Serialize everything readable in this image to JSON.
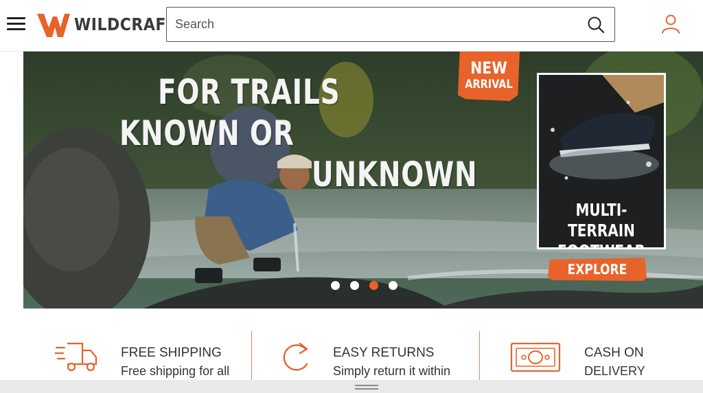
{
  "header": {
    "brand": "WILDCRAFT",
    "search_placeholder": "Search"
  },
  "banner": {
    "headline_line1": "FOR TRAILS",
    "headline_line2": "KNOWN OR",
    "headline_line3": "UNKNOWN",
    "badge_line1": "NEW",
    "badge_line2": "ARRIVAL",
    "promo_line1": "MULTI-TERRAIN",
    "promo_line2": "FOOTWEAR",
    "cta_label": "EXPLORE",
    "slide_count": 4,
    "active_slide": 3
  },
  "features": [
    {
      "icon": "truck-icon",
      "title": "FREE SHIPPING",
      "desc": "Free shipping for all"
    },
    {
      "icon": "return-arrow-icon",
      "title": "EASY RETURNS",
      "desc": "Simply return it within"
    },
    {
      "icon": "cash-icon",
      "title": "CASH ON",
      "desc": "DELIVERY"
    }
  ],
  "colors": {
    "brand_orange": "#e8632a",
    "text_dark": "#333333",
    "border": "#555555"
  }
}
